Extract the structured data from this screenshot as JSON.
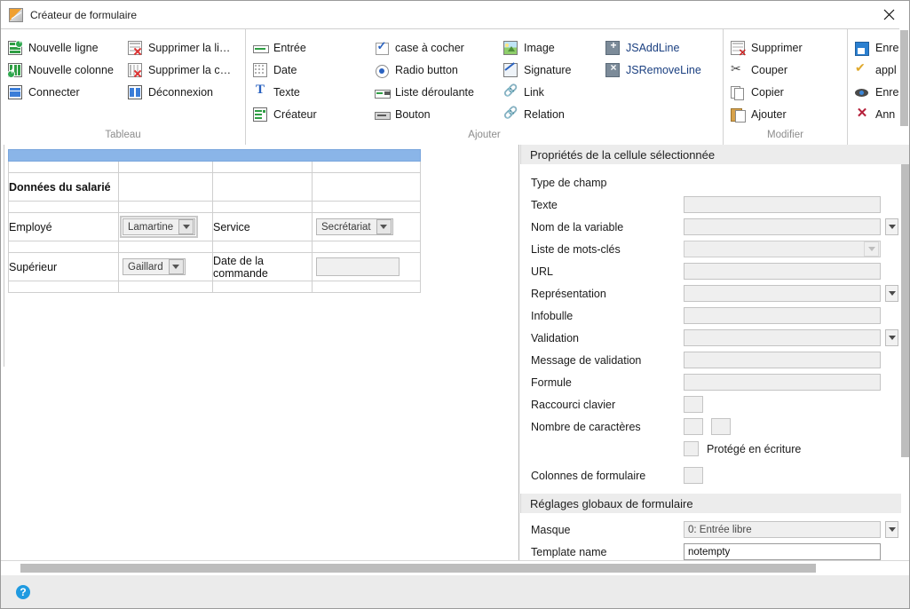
{
  "window": {
    "title": "Créateur de formulaire",
    "title_icon": "form-designer-icon",
    "close_icon": "close-icon"
  },
  "ribbon": {
    "groups": [
      {
        "label": "Tableau",
        "columns": [
          {
            "items": [
              {
                "label": "Nouvelle ligne",
                "icon": "new-row-icon"
              },
              {
                "label": "Nouvelle colonne",
                "icon": "new-column-icon"
              },
              {
                "label": "Connecter",
                "icon": "merge-cells-icon"
              }
            ]
          },
          {
            "items": [
              {
                "label": "Supprimer la li…",
                "icon": "delete-row-icon"
              },
              {
                "label": "Supprimer la c…",
                "icon": "delete-column-icon"
              },
              {
                "label": "Déconnexion",
                "icon": "split-cells-icon"
              }
            ]
          }
        ]
      },
      {
        "label": "Ajouter",
        "columns": [
          {
            "items": [
              {
                "label": "Entrée",
                "icon": "input-field-icon"
              },
              {
                "label": "Date",
                "icon": "date-picker-icon"
              },
              {
                "label": "Texte",
                "icon": "text-label-icon"
              },
              {
                "label": "Créateur",
                "icon": "creator-icon"
              }
            ]
          },
          {
            "items": [
              {
                "label": "case à cocher",
                "icon": "checkbox-icon"
              },
              {
                "label": "Radio button",
                "icon": "radio-button-icon"
              },
              {
                "label": "Liste déroulante",
                "icon": "dropdown-icon"
              },
              {
                "label": "Bouton",
                "icon": "button-icon"
              }
            ]
          },
          {
            "items": [
              {
                "label": "Image",
                "icon": "image-icon"
              },
              {
                "label": "Signature",
                "icon": "signature-icon"
              },
              {
                "label": "Link",
                "icon": "link-icon"
              },
              {
                "label": "Relation",
                "icon": "relation-icon"
              }
            ]
          },
          {
            "items": [
              {
                "label": "JSAddLine",
                "icon": "js-add-line-icon"
              },
              {
                "label": "JSRemoveLine",
                "icon": "js-remove-line-icon"
              }
            ]
          }
        ]
      },
      {
        "label": "Modifier",
        "columns": [
          {
            "items": [
              {
                "label": "Supprimer",
                "icon": "delete-icon"
              },
              {
                "label": "Couper",
                "icon": "cut-icon"
              },
              {
                "label": "Copier",
                "icon": "copy-icon"
              },
              {
                "label": "Ajouter",
                "icon": "paste-icon"
              }
            ]
          }
        ]
      },
      {
        "label": "",
        "columns": [
          {
            "items": [
              {
                "label": "Enre",
                "icon": "save-icon"
              },
              {
                "label": "appl",
                "icon": "apply-icon"
              },
              {
                "label": "Enre",
                "icon": "preview-icon"
              },
              {
                "label": "Ann",
                "icon": "cancel-icon"
              }
            ]
          }
        ]
      }
    ]
  },
  "canvas": {
    "form": {
      "rows": [
        {
          "type": "titlebar"
        },
        {
          "type": "spacer"
        },
        {
          "type": "data",
          "cells": [
            {
              "kind": "label",
              "text": "Données du salarié",
              "bold": true
            },
            {
              "kind": "empty"
            },
            {
              "kind": "empty"
            },
            {
              "kind": "empty"
            }
          ]
        },
        {
          "type": "spacer"
        },
        {
          "type": "data",
          "cells": [
            {
              "kind": "label",
              "text": "Employé"
            },
            {
              "kind": "dropdown",
              "value": "Lamartine",
              "selected": true
            },
            {
              "kind": "label",
              "text": "Service"
            },
            {
              "kind": "dropdown",
              "value": "Secrétariat",
              "selected": false
            }
          ]
        },
        {
          "type": "spacer"
        },
        {
          "type": "data",
          "cells": [
            {
              "kind": "label",
              "text": "Supérieur"
            },
            {
              "kind": "dropdown",
              "value": "Gaillard",
              "selected": false
            },
            {
              "kind": "label",
              "text": "Date de la commande"
            },
            {
              "kind": "textbox",
              "value": ""
            }
          ]
        },
        {
          "type": "spacer"
        }
      ]
    }
  },
  "properties": {
    "cell_section_title": "Propriétés de la cellule sélectionnée",
    "cell_rows": [
      {
        "label": "Type de champ",
        "control": "none",
        "value": ""
      },
      {
        "label": "Texte",
        "control": "field",
        "value": ""
      },
      {
        "label": "Nom de la variable",
        "control": "field-drop",
        "value": ""
      },
      {
        "label": "Liste de mots-clés",
        "control": "combo",
        "value": ""
      },
      {
        "label": "URL",
        "control": "field",
        "value": ""
      },
      {
        "label": "Représentation",
        "control": "field-drop",
        "value": ""
      },
      {
        "label": "Infobulle",
        "control": "field",
        "value": ""
      },
      {
        "label": "Validation",
        "control": "field-drop",
        "value": ""
      },
      {
        "label": "Message de validation",
        "control": "field",
        "value": ""
      },
      {
        "label": "Formule",
        "control": "field",
        "value": ""
      },
      {
        "label": "Raccourci clavier",
        "control": "small",
        "value": ""
      },
      {
        "label": "Nombre de caractères",
        "control": "small2",
        "value": ""
      }
    ],
    "write_protected": {
      "label": "Protégé en écriture",
      "checked": false
    },
    "form_columns": {
      "label": "Colonnes de formulaire",
      "value": ""
    },
    "global_section_title": "Réglages globaux de formulaire",
    "global_rows": [
      {
        "label": "Masque",
        "control": "field-drop",
        "value": "0: Entrée libre"
      },
      {
        "label": "Template name",
        "control": "field-white",
        "value": "notempty"
      }
    ]
  },
  "statusbar": {
    "help_icon": "help-icon"
  },
  "colors": {
    "form_title_bar": "#8ab5e8",
    "section_header": "#ececec",
    "status_bar": "#ebebeb",
    "accent_blue": "#1f9ae0"
  }
}
